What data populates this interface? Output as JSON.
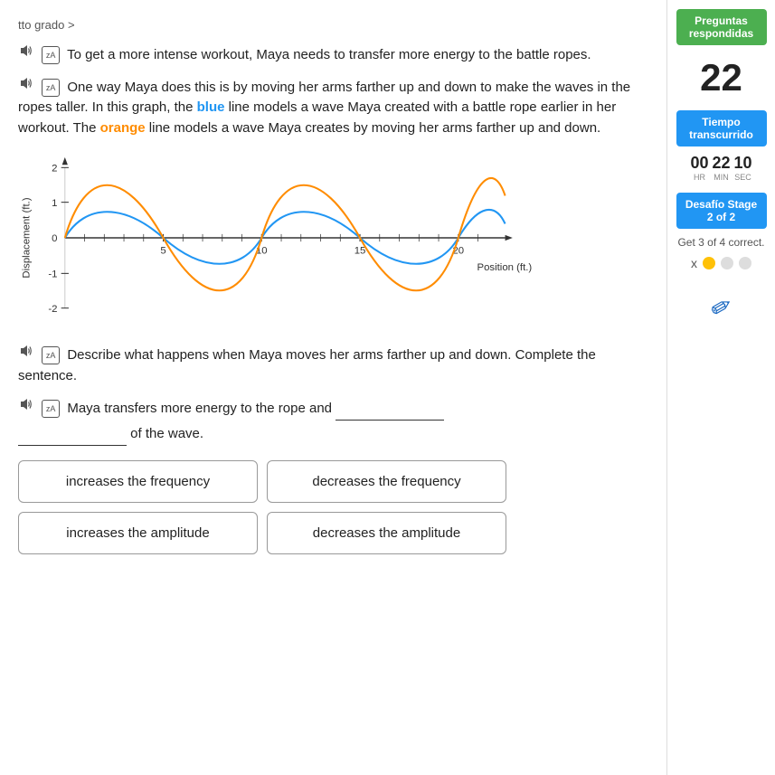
{
  "breadcrumb": "tto grado",
  "sidebar": {
    "preguntas_label": "Preguntas respondidas",
    "score": "22",
    "tiempo_label": "Tiempo transcurrido",
    "timer": {
      "hr": "00",
      "min": "22",
      "sec": "10"
    },
    "desafio_label": "Desafío Stage 2 of 2",
    "get_correct": "Get 3 of 4 correct.",
    "dot_x": "x"
  },
  "paragraphs": {
    "p1": "To get a more intense workout, Maya needs to transfer more energy to the battle ropes.",
    "p2_start": "One way Maya does this is by moving her arms farther up and down to make the waves in the ropes taller. In this graph, the ",
    "p2_blue": "blue",
    "p2_mid": " line models a wave Maya created with a battle rope earlier in her workout. The ",
    "p2_orange": "orange",
    "p2_end": " line models a wave Maya creates by moving her arms farther up and down.",
    "p3_start": "Describe what happens when Maya moves her arms farther up and down. Complete the sentence.",
    "p4_start": "Maya transfers more energy to the rope and",
    "p4_end": "of the wave."
  },
  "graph": {
    "y_label": "Displacement (ft.)",
    "x_label": "Position (ft.)",
    "y_values": [
      "2",
      "1",
      "0",
      "-1",
      "-2"
    ],
    "x_values": [
      "5",
      "10",
      "15",
      "20"
    ]
  },
  "options": [
    {
      "id": "opt1",
      "label": "increases the frequency"
    },
    {
      "id": "opt2",
      "label": "decreases the frequency"
    },
    {
      "id": "opt3",
      "label": "increases the amplitude"
    },
    {
      "id": "opt4",
      "label": "decreases the amplitude"
    }
  ]
}
